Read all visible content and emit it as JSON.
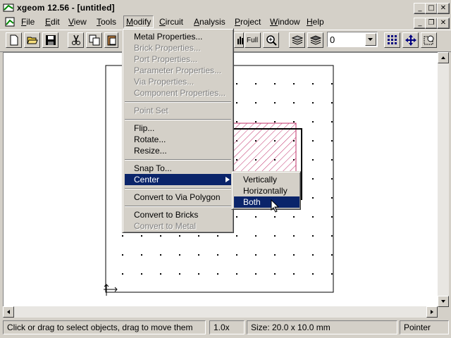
{
  "window": {
    "title": "xgeom 12.56 - [untitled]"
  },
  "menubar": {
    "file": "File",
    "edit": "Edit",
    "view": "View",
    "tools": "Tools",
    "modify": "Modify",
    "circuit": "Circuit",
    "analysis": "Analysis",
    "project": "Project",
    "window": "Window",
    "help": "Help"
  },
  "toolbar": {
    "full_label": "Full",
    "level_combo_value": "0"
  },
  "modify_menu": {
    "items": [
      "Metal Properties...",
      "Brick Properties...",
      "Port Properties...",
      "Parameter Properties...",
      "Via Properties...",
      "Component Properties...",
      "Point Set",
      "Flip...",
      "Rotate...",
      "Resize...",
      "Snap To...",
      "Center",
      "Convert to Via Polygon",
      "Convert to Bricks",
      "Convert to Metal"
    ]
  },
  "center_submenu": {
    "items": [
      "Vertically",
      "Horizontally",
      "Both"
    ]
  },
  "statusbar": {
    "hint": "Click or drag to select objects, drag to move them",
    "zoom": "1.0x",
    "size": "Size: 20.0 x 10.0 mm",
    "mode": "Pointer"
  },
  "colors": {
    "highlight": "#0a246a",
    "hatch": "#c0306a",
    "face": "#d4d0c8"
  }
}
